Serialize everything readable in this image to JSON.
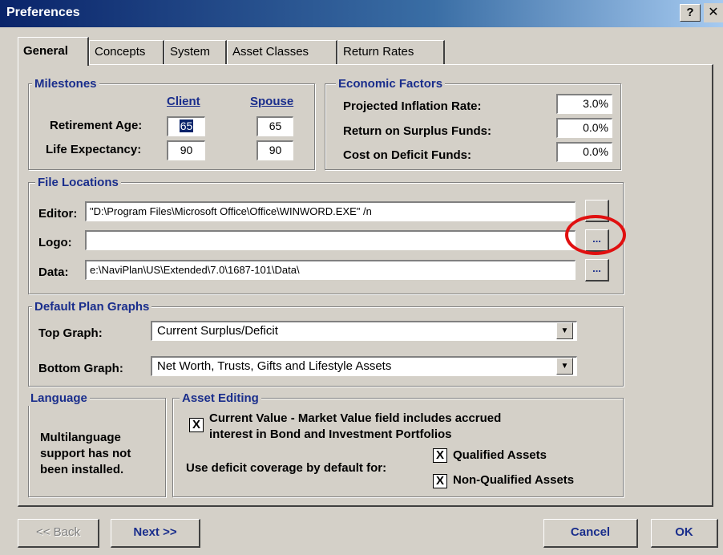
{
  "window": {
    "title": "Preferences",
    "help_label": "?",
    "close_label": "✕"
  },
  "tabs": [
    {
      "label": "General",
      "active": true
    },
    {
      "label": "Concepts"
    },
    {
      "label": "System"
    },
    {
      "label": "Asset Classes"
    },
    {
      "label": "Return Rates"
    }
  ],
  "milestones": {
    "title": "Milestones",
    "client_header": "Client",
    "spouse_header": "Spouse",
    "retirement_label": "Retirement Age:",
    "life_label": "Life Expectancy:",
    "client_retirement": "65",
    "spouse_retirement": "65",
    "client_life": "90",
    "spouse_life": "90"
  },
  "economic": {
    "title": "Economic Factors",
    "inflation_label": "Projected Inflation Rate:",
    "inflation_value": "3.0%",
    "surplus_label": "Return on Surplus Funds:",
    "surplus_value": "0.0%",
    "deficit_label": "Cost on Deficit Funds:",
    "deficit_value": "0.0%"
  },
  "files": {
    "title": "File Locations",
    "editor_label": "Editor:",
    "editor_value": "\"D:\\Program Files\\Microsoft Office\\Office\\WINWORD.EXE\" /n",
    "logo_label": "Logo:",
    "logo_value": "",
    "data_label": "Data:",
    "data_value": "e:\\NaviPlan\\US\\Extended\\7.0\\1687-101\\Data\\",
    "browse_label": "..."
  },
  "graphs": {
    "title": "Default Plan Graphs",
    "top_label": "Top Graph:",
    "top_value": "Current Surplus/Deficit",
    "bottom_label": "Bottom Graph:",
    "bottom_value": "Net Worth, Trusts, Gifts and Lifestyle Assets"
  },
  "language": {
    "title": "Language",
    "line1": "Multilanguage",
    "line2": "support has not",
    "line3": "been installed."
  },
  "asset_editing": {
    "title": "Asset Editing",
    "current_value_line1": "Current Value - Market Value field includes accrued",
    "current_value_line2": "interest in Bond and Investment Portfolios",
    "deficit_label": "Use deficit coverage by default for:",
    "qualified_label": "Qualified Assets",
    "nonqualified_label": "Non-Qualified Assets",
    "check_mark": "X"
  },
  "footer": {
    "back_label": "<< Back",
    "next_label": "Next >>",
    "cancel_label": "Cancel",
    "ok_label": "OK"
  },
  "colors": {
    "accent": "#1a2e8c",
    "highlight_ring": "#e01010"
  }
}
